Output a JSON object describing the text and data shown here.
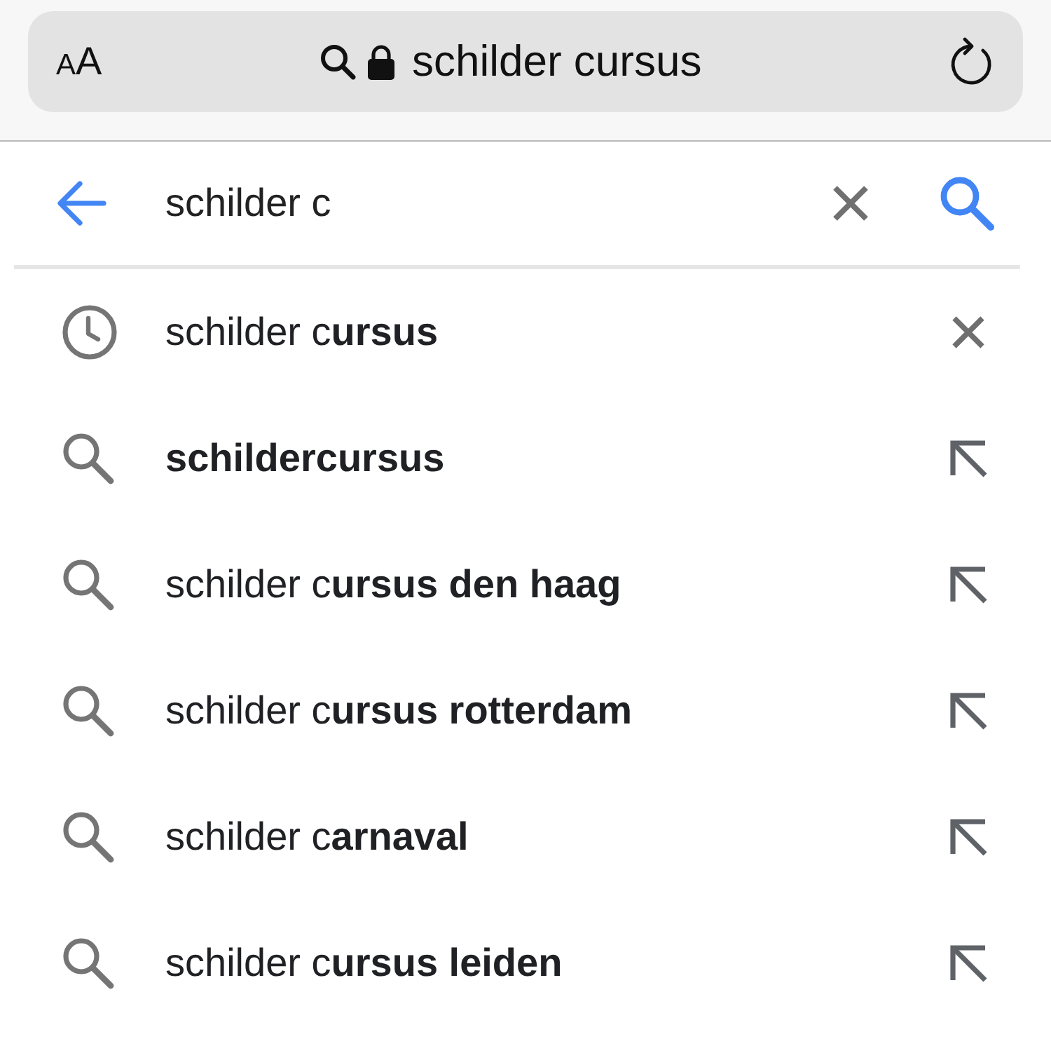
{
  "address_bar": {
    "text_size_button": "AA",
    "url_text": "schilder cursus"
  },
  "search": {
    "value": "schilder c"
  },
  "suggestions": [
    {
      "kind": "history",
      "text": "schilder c**ursus**"
    },
    {
      "kind": "search",
      "text": "**schildercursus**"
    },
    {
      "kind": "search",
      "text": "schilder c**ursus den haag**"
    },
    {
      "kind": "search",
      "text": "schilder c**ursus rotterdam**"
    },
    {
      "kind": "search",
      "text": "schilder c**arnaval**"
    },
    {
      "kind": "search",
      "text": "schilder c**ursus leiden**"
    }
  ]
}
